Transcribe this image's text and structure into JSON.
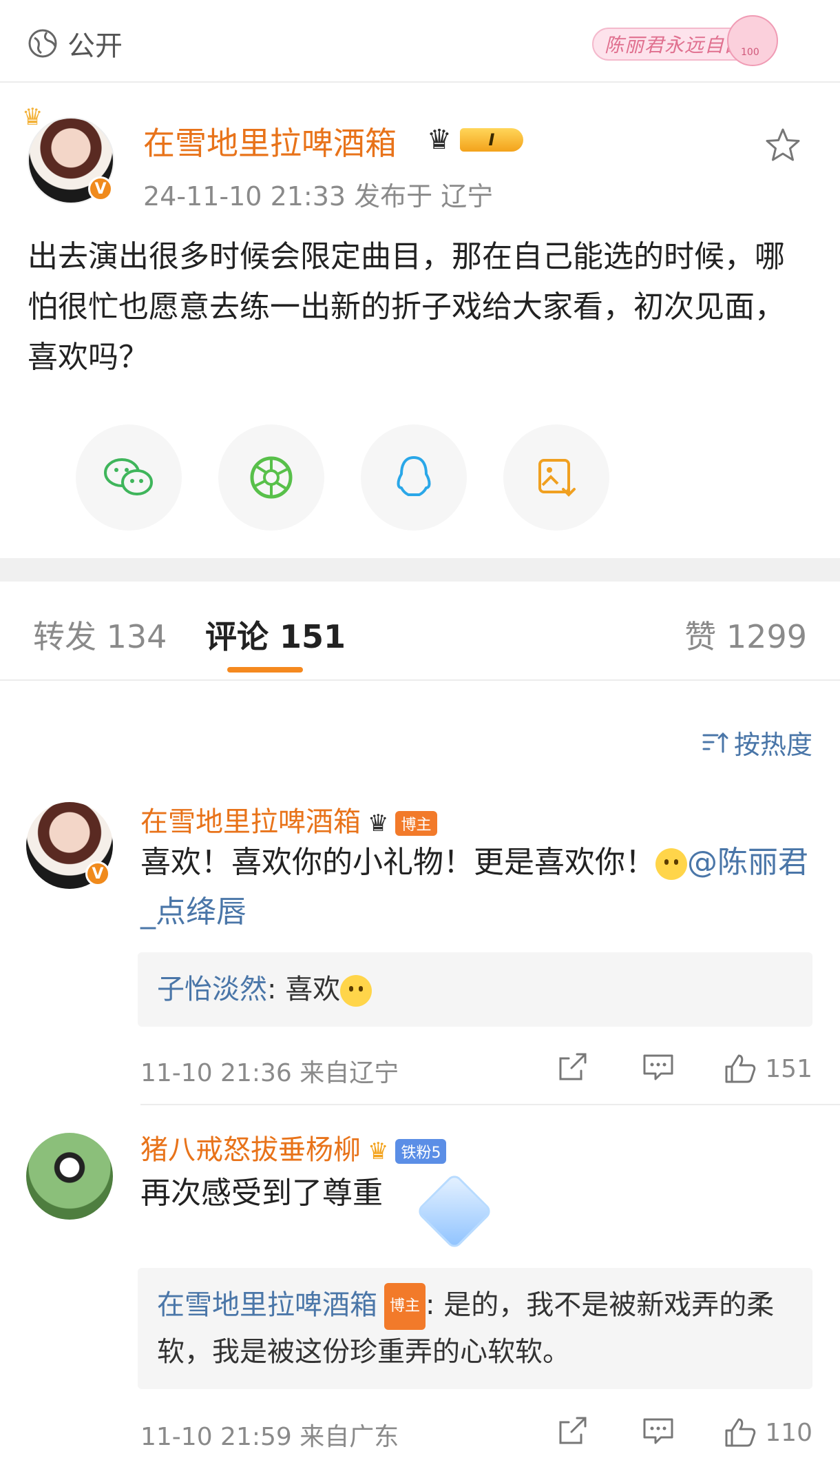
{
  "topbar": {
    "visibility_label": "公开",
    "sticker_text": "陈丽君永远自由"
  },
  "post": {
    "author_name": "在雪地里拉啤酒箱",
    "level_label": "I",
    "meta": "24-11-10 21:33  发布于 辽宁",
    "text": "出去演出很多时候会限定曲目，那在自己能选的时候，哪怕很忙也愿意去练一出新的折子戏给大家看，初次见面，喜欢吗？"
  },
  "share": {
    "icons": [
      "wechat-icon",
      "moments-icon",
      "qq-icon",
      "save-image-icon"
    ]
  },
  "tabs": {
    "repost": "转发 134",
    "comment": "评论 151",
    "like": "赞 1299"
  },
  "sort": {
    "label": "按热度"
  },
  "comments": [
    {
      "name": "在雪地里拉啤酒箱",
      "tag": "博主",
      "body": "喜欢！喜欢你的小礼物！更是喜欢你！",
      "mention": "@陈丽君_点绛唇",
      "reply_name": "子怡淡然",
      "reply_text": ": 喜欢",
      "time": "11-10 21:36 来自辽宁",
      "likes": "151"
    },
    {
      "name": "猪八戒怒拔垂杨柳",
      "tag": "铁粉5",
      "body": "再次感受到了尊重",
      "reply_name": "在雪地里拉啤酒箱",
      "reply_tag": "博主",
      "reply_text": ": 是的，我不是被新戏弄的柔软，我是被这份珍重弄的心软软。",
      "time": "11-10 21:59 来自广东",
      "likes": "110"
    }
  ],
  "colors": {
    "accent_orange": "#e8731a",
    "link_blue": "#4a76a8",
    "tab_underline": "#f5891f"
  }
}
